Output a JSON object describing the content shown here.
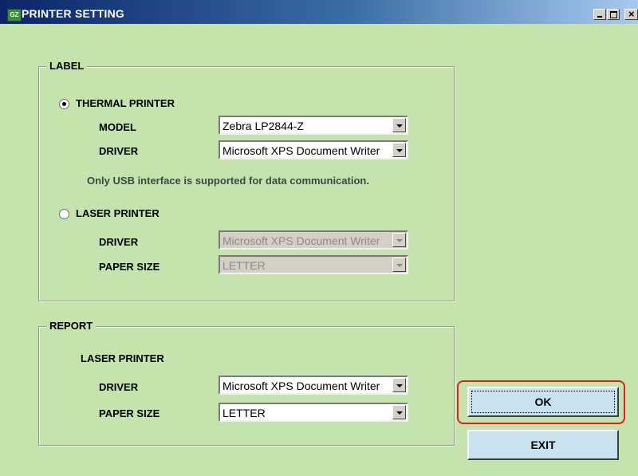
{
  "window": {
    "title": "PRINTER SETTING",
    "icon_text": "GZ"
  },
  "label_group": {
    "legend": "LABEL",
    "thermal": {
      "option_label": "THERMAL PRINTER",
      "selected": true,
      "model_label": "MODEL",
      "model_value": "Zebra LP2844-Z",
      "driver_label": "DRIVER",
      "driver_value": "Microsoft XPS Document Writer",
      "note": "Only USB interface is supported for data communication."
    },
    "laser": {
      "option_label": "LASER PRINTER",
      "selected": false,
      "driver_label": "DRIVER",
      "driver_value": "Microsoft XPS Document Writer",
      "paper_label": "PAPER SIZE",
      "paper_value": "LETTER"
    }
  },
  "report_group": {
    "legend": "REPORT",
    "subheading": "LASER PRINTER",
    "driver_label": "DRIVER",
    "driver_value": "Microsoft XPS Document Writer",
    "paper_label": "PAPER SIZE",
    "paper_value": "LETTER"
  },
  "buttons": {
    "ok": "OK",
    "exit": "EXIT"
  },
  "colors": {
    "background": "#c4e3ad",
    "button": "#c8e3ef",
    "highlight": "#e0201c"
  },
  "icons": [
    "minimize-icon",
    "maximize-icon",
    "close-icon",
    "app-icon",
    "dropdown-arrow-icon"
  ]
}
